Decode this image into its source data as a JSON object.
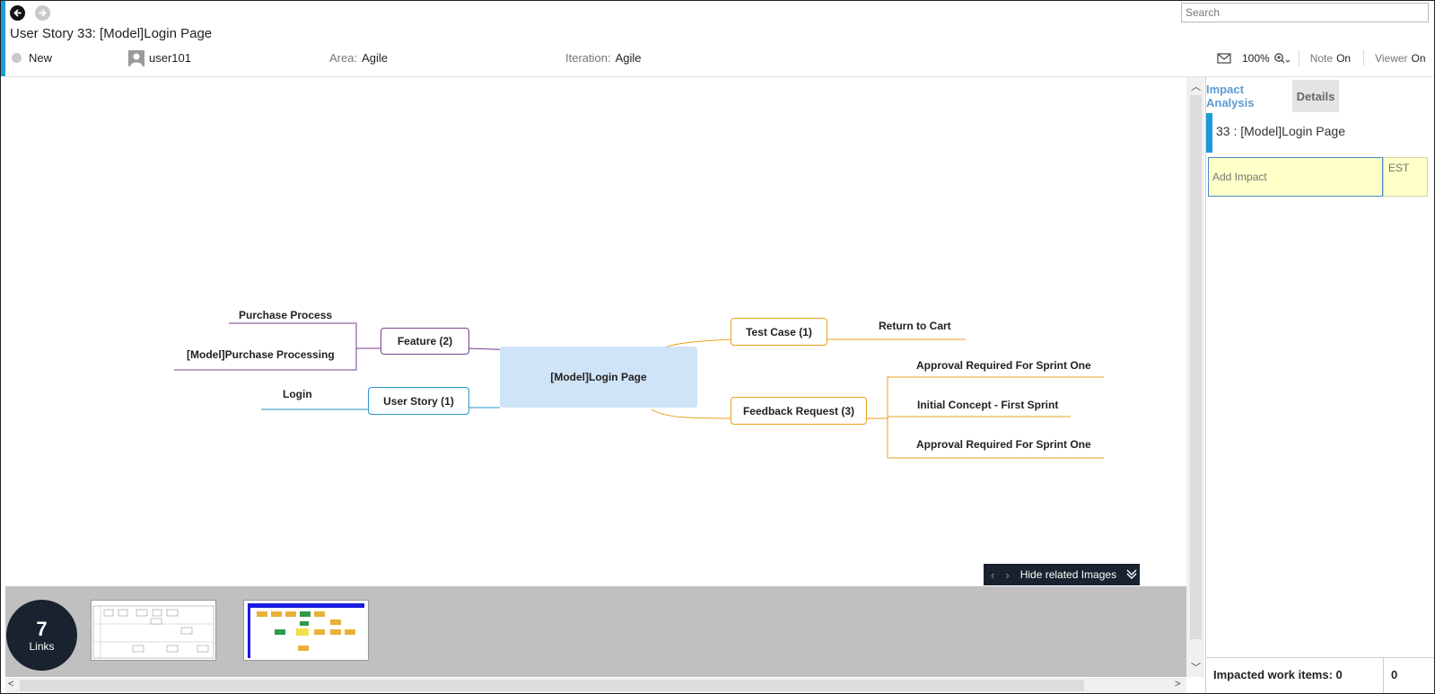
{
  "header": {
    "search_placeholder": "Search",
    "title": "User Story 33: [Model]Login Page",
    "state": "New",
    "assignee": "user101",
    "area_label": "Area:",
    "area_value": "Agile",
    "iteration_label": "Iteration:",
    "iteration_value": "Agile",
    "zoom": "100%",
    "note_label": "Note",
    "note_value": "On",
    "viewer_label": "Viewer",
    "viewer_value": "On"
  },
  "mindmap": {
    "center": "[Model]Login Page",
    "nodes": [
      {
        "label": "Feature (2)",
        "children": [
          "Purchase Process",
          "[Model]Purchase Processing"
        ]
      },
      {
        "label": "User Story (1)",
        "children": [
          "Login"
        ]
      },
      {
        "label": "Test Case (1)",
        "children": [
          "Return to Cart"
        ]
      },
      {
        "label": "Feedback Request (3)",
        "children": [
          "Approval Required For Sprint One",
          "Initial Concept - First Sprint",
          "Approval Required For Sprint One"
        ]
      }
    ]
  },
  "colors": {
    "accent": "#1b9bd7",
    "feature": "#7b3f8c",
    "user_story": "#2a93c8",
    "test_case": "#e8a21c",
    "center_fill": "#cfe4f7",
    "dark": "#19222e"
  },
  "images": {
    "hide_label": "Hide related Images",
    "links_count": "7",
    "links_label": "Links"
  },
  "panel": {
    "tabs": [
      "Impact Analysis",
      "Details"
    ],
    "item_title": "33 : [Model]Login Page",
    "add_impact_placeholder": "Add Impact",
    "est_label": "EST",
    "impacted_label": "Impacted work items: 0",
    "impacted_total": "0"
  }
}
